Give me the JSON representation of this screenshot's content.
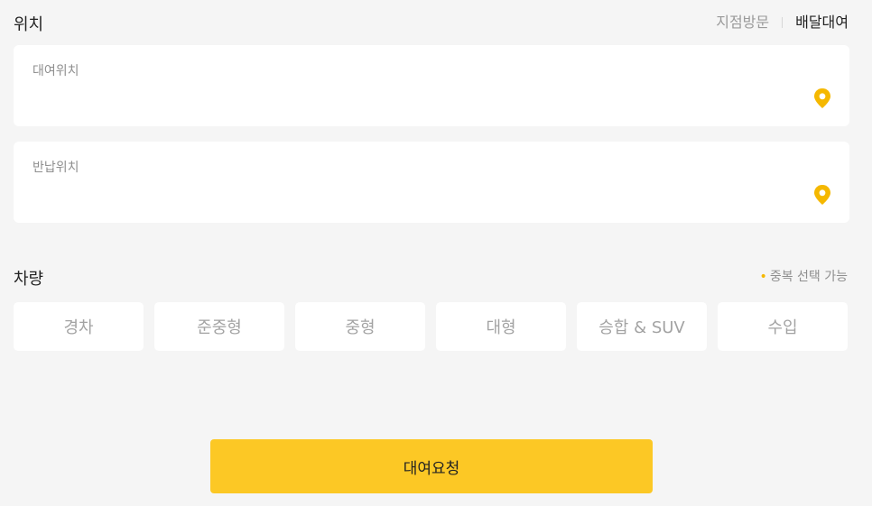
{
  "location": {
    "title": "위치",
    "modes": [
      {
        "label": "지점방문",
        "active": false
      },
      {
        "label": "배달대여",
        "active": true
      }
    ],
    "rental_label": "대여위치",
    "return_label": "반납위치"
  },
  "vehicle": {
    "title": "차량",
    "multi_select_note": "중복 선택 가능",
    "note_bullet": "•",
    "types": [
      "경차",
      "준중형",
      "중형",
      "대형",
      "승합 & SUV",
      "수입"
    ]
  },
  "submit": {
    "label": "대여요청"
  },
  "colors": {
    "accent": "#fcc825",
    "pin": "#f5b800",
    "background": "#f5f5f5",
    "card": "#ffffff",
    "muted_text": "#a3a3a3"
  },
  "icons": {
    "pin": "map-pin-icon"
  }
}
